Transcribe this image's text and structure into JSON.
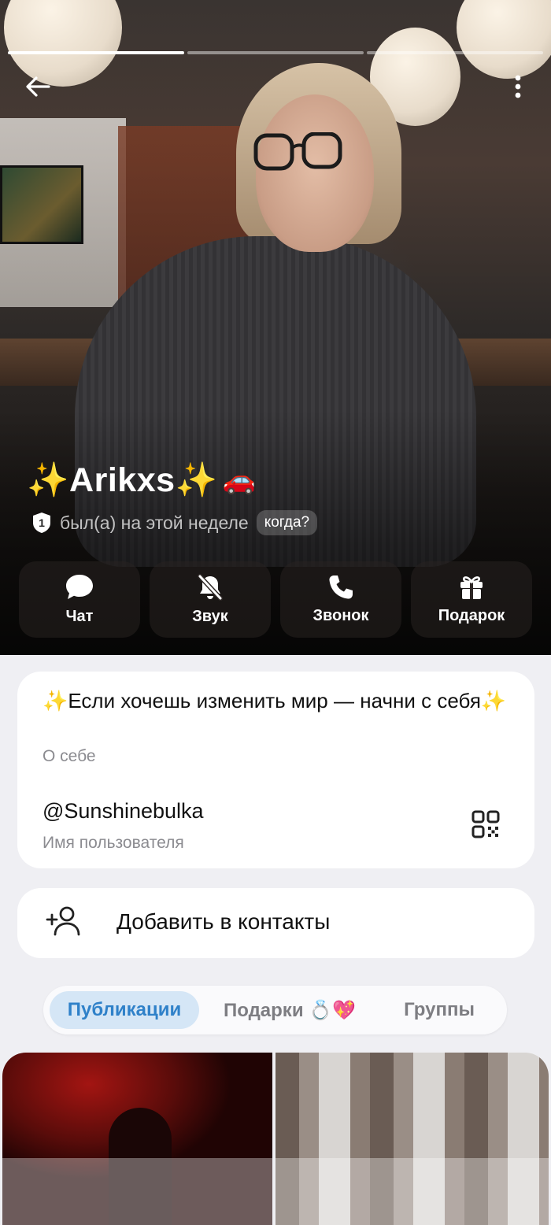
{
  "profile": {
    "name": "✨Arikxs✨",
    "name_emoji": "🚗",
    "status": "был(а) на этой неделе",
    "status_badge": "1",
    "when_label": "когда?"
  },
  "actions": [
    {
      "label": "Чат",
      "icon": "chat-icon"
    },
    {
      "label": "Звук",
      "icon": "bell-off-icon"
    },
    {
      "label": "Звонок",
      "icon": "phone-icon"
    },
    {
      "label": "Подарок",
      "icon": "gift-icon"
    }
  ],
  "info": {
    "bio": "✨Если хочешь изменить мир — начни с себя✨",
    "bio_label": "О себе",
    "username": "@Sunshinebulka",
    "username_label": "Имя пользователя"
  },
  "contact": {
    "label": "Добавить в контакты",
    "icon": "add-user-icon"
  },
  "tabs": [
    {
      "label": "Публикации",
      "active": true
    },
    {
      "label": "Подарки 💍💖",
      "active": false
    },
    {
      "label": "Группы",
      "active": false
    }
  ],
  "stories": {
    "count": 3,
    "active_index": 0
  },
  "colors": {
    "accent": "#2f81c9",
    "tab_active_bg": "#d5e6f6",
    "page_bg": "#efeff3"
  }
}
